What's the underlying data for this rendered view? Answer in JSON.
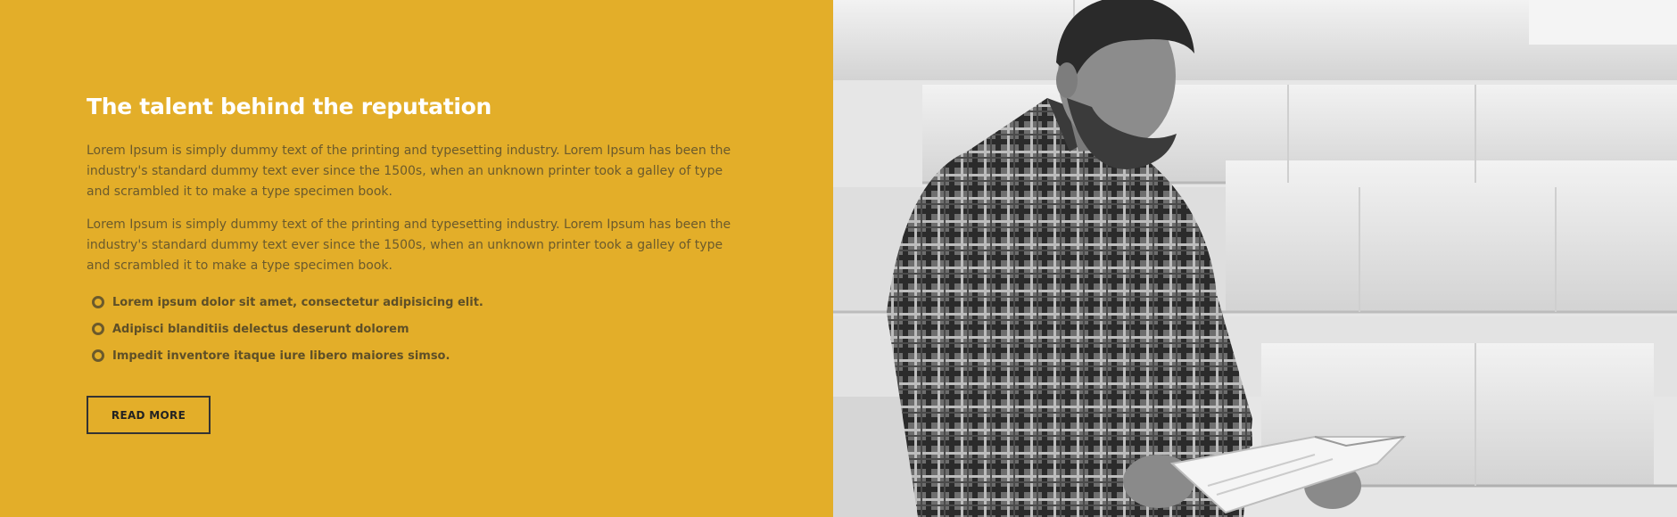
{
  "about": {
    "title": "The talent behind the reputation",
    "paragraphs": [
      "Lorem Ipsum is simply dummy text of the printing and typesetting industry. Lorem Ipsum has been the industry's standard dummy text ever since the 1500s, when an unknown printer took a galley of type and scrambled it to make a type specimen book.",
      "Lorem Ipsum is simply dummy text of the printing and typesetting industry. Lorem Ipsum has been the industry's standard dummy text ever since the 1500s, when an unknown printer took a galley of type and scrambled it to make a type specimen book."
    ],
    "list_items": [
      "Lorem ipsum dolor sit amet, consectetur adipisicing elit.",
      "Adipisci blanditiis delectus deserunt dolorem",
      "Impedit inventore itaque iure libero maiores simso."
    ],
    "button_label": "READ MORE"
  },
  "colors": {
    "panel_background": "#e3ae29",
    "title_text": "#ffffff",
    "body_text": "#6b5a2c",
    "button_border": "#333333"
  },
  "photo": {
    "subject": "black-and-white photo of a man in a plaid shirt reading a book on stone steps"
  }
}
